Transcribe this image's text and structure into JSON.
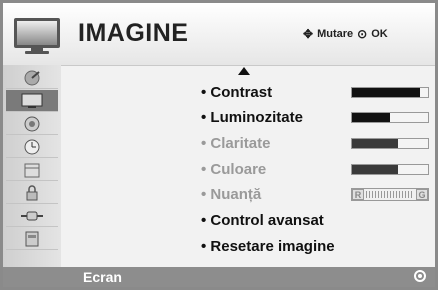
{
  "header": {
    "title": "IMAGINE",
    "move_hint": "Mutare",
    "ok_hint": "OK",
    "move_icon": "dpad-arrows-icon",
    "ok_icon": "ok-button-icon"
  },
  "sidebar": {
    "items": [
      {
        "icon": "satellite-dish-icon"
      },
      {
        "icon": "tv-picture-icon",
        "active": true
      },
      {
        "icon": "speaker-icon"
      },
      {
        "icon": "clock-icon"
      },
      {
        "icon": "calendar-icon"
      },
      {
        "icon": "lock-icon"
      },
      {
        "icon": "input-plug-icon"
      },
      {
        "icon": "remote-menu-icon"
      }
    ]
  },
  "menu": {
    "items": [
      {
        "label": "• Contrast",
        "value": "90",
        "level": 90,
        "dim": false
      },
      {
        "label": "• Luminozitate",
        "value": "50",
        "level": 50,
        "dim": false
      },
      {
        "label": "• Claritate",
        "value": "60",
        "level": 60,
        "dim": true
      },
      {
        "label": "• Culoare",
        "value": "60",
        "level": 60,
        "dim": true
      },
      {
        "label": "• Nuanță",
        "value": "0",
        "dim": true,
        "balance_left": "R",
        "balance_right": "G"
      },
      {
        "label": "• Control avansat"
      },
      {
        "label": "• Resetare imagine"
      }
    ]
  },
  "footer": {
    "label": "Ecran"
  },
  "colors": {
    "header_bg": "#f0f0f0",
    "active_bg": "#7a7a7a",
    "footer_bg": "#8d8d8d",
    "text": "#111111",
    "dim_text": "#9a9a9a"
  }
}
